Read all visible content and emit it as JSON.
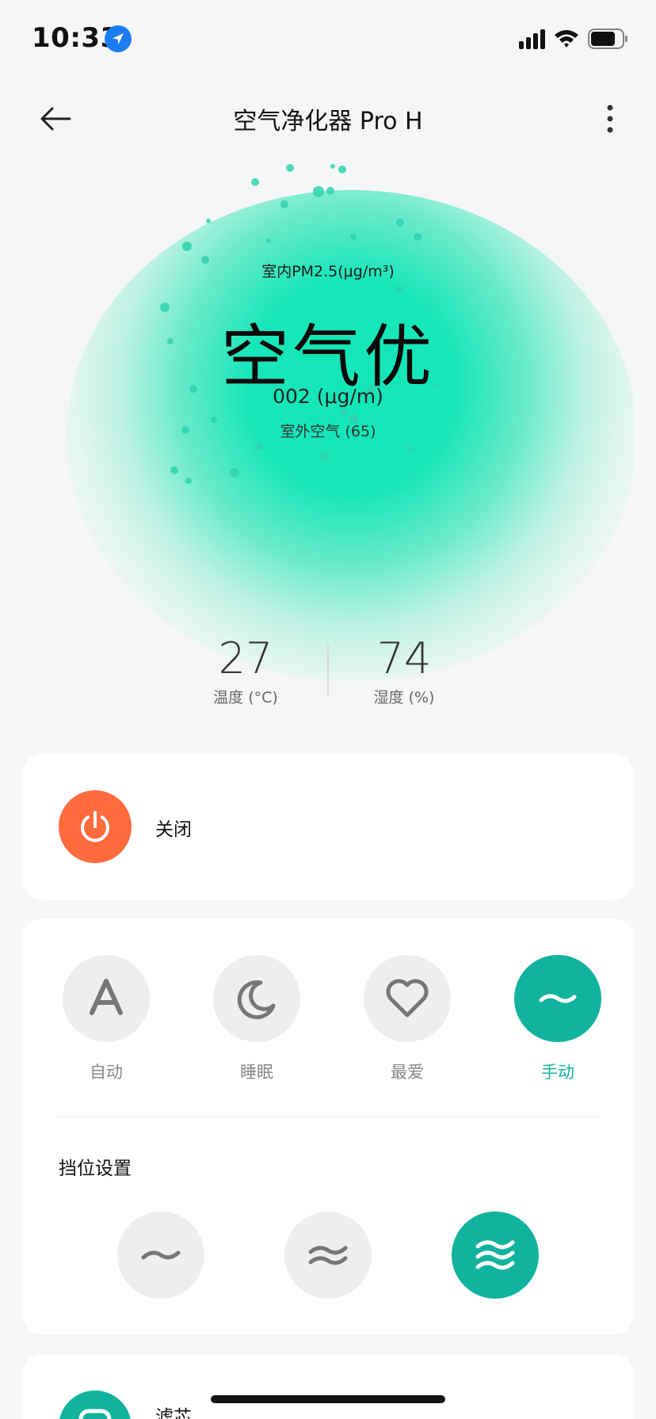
{
  "status_bar": {
    "time": "10:33",
    "location_icon": "location-arrow-icon",
    "signal_icon": "cellular-signal-icon",
    "wifi_icon": "wifi-icon",
    "battery_icon": "battery-icon"
  },
  "header": {
    "title": "空气净化器 Pro H",
    "back_icon": "back-arrow-icon",
    "more_icon": "more-vertical-icon"
  },
  "hero": {
    "pm_label": "室内PM2.5(μg/m³)",
    "air_quality": "空气优",
    "pm_value": "002 (μg/m)",
    "outdoor": "室外空气 (65)",
    "glow_color": "#12e6b8"
  },
  "stats": {
    "temperature": {
      "value": "27",
      "label": "温度 (°C)"
    },
    "humidity": {
      "value": "74",
      "label": "湿度 (%)"
    }
  },
  "power": {
    "label": "关闭",
    "icon": "power-icon",
    "color": "#ff6b3d"
  },
  "modes": {
    "items": [
      {
        "label": "自动",
        "icon": "auto-a-icon",
        "active": false
      },
      {
        "label": "睡眠",
        "icon": "moon-icon",
        "active": false
      },
      {
        "label": "最爱",
        "icon": "heart-icon",
        "active": false
      },
      {
        "label": "手动",
        "icon": "wave-icon",
        "active": true
      }
    ],
    "accent_color": "#12b39e"
  },
  "gear": {
    "title": "挡位设置",
    "levels": [
      {
        "icon": "wave-level-1-icon",
        "active": false
      },
      {
        "icon": "wave-level-2-icon",
        "active": false
      },
      {
        "icon": "wave-level-3-icon",
        "active": true
      }
    ]
  },
  "filter": {
    "label": "滤芯",
    "icon": "filter-icon"
  }
}
